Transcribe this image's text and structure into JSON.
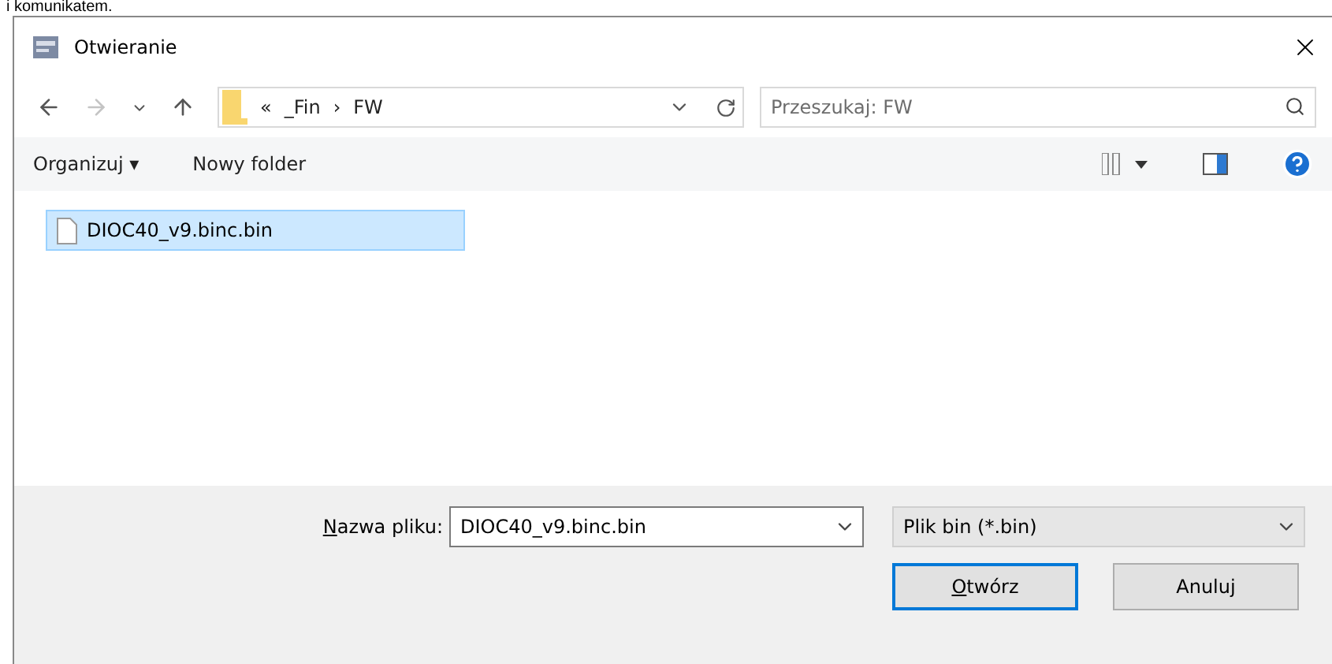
{
  "background_text": "i komunikatem.",
  "window": {
    "title": "Otwieranie"
  },
  "navigation": {
    "back_disabled": false,
    "forward_disabled": true,
    "path": [
      {
        "label": "«"
      },
      {
        "label": "_Fin"
      },
      {
        "label": "›"
      },
      {
        "label": "FW"
      }
    ],
    "search": {
      "placeholder": "Przeszukaj: FW"
    }
  },
  "toolbar": {
    "organize": "Organizuj ▾",
    "new_folder": "Nowy folder"
  },
  "files": [
    {
      "name": "DIOC40_v9.binc.bin",
      "selected": true
    }
  ],
  "footer": {
    "filename_label": "Nazwa pliku:",
    "filename_label_first_letter_underlined": true,
    "filename": "DIOC40_v9.binc.bin",
    "filetype": "Plik bin (*.bin)",
    "buttons": [
      {
        "label": "Otwórz",
        "first_letter_underlined": true,
        "default": true
      },
      {
        "label": "Anuluj",
        "first_letter_underlined": false,
        "default": false
      }
    ]
  }
}
